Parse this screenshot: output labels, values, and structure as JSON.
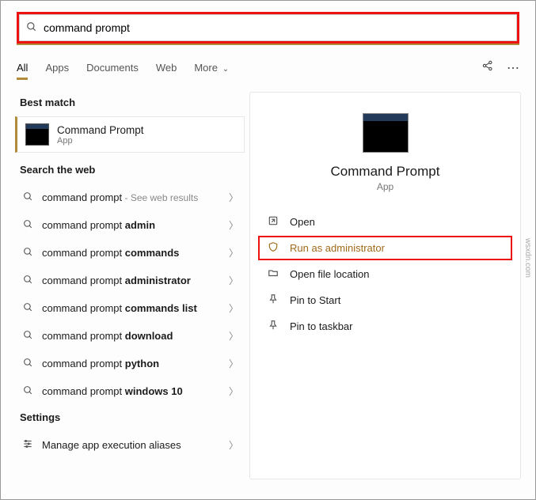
{
  "search": {
    "value": "command prompt"
  },
  "tabs": [
    "All",
    "Apps",
    "Documents",
    "Web",
    "More"
  ],
  "bestMatchHeader": "Best match",
  "bestMatch": {
    "title": "Command Prompt",
    "subtitle": "App"
  },
  "webHeader": "Search the web",
  "webItems": [
    {
      "prefix": "command prompt",
      "bold": "",
      "suffix": " - See web results"
    },
    {
      "prefix": "command prompt ",
      "bold": "admin",
      "suffix": ""
    },
    {
      "prefix": "command prompt ",
      "bold": "commands",
      "suffix": ""
    },
    {
      "prefix": "command prompt ",
      "bold": "administrator",
      "suffix": ""
    },
    {
      "prefix": "command prompt ",
      "bold": "commands list",
      "suffix": ""
    },
    {
      "prefix": "command prompt ",
      "bold": "download",
      "suffix": ""
    },
    {
      "prefix": "command prompt ",
      "bold": "python",
      "suffix": ""
    },
    {
      "prefix": "command prompt ",
      "bold": "windows 10",
      "suffix": ""
    }
  ],
  "settingsHeader": "Settings",
  "settingsItem": "Manage app execution aliases",
  "detail": {
    "title": "Command Prompt",
    "subtitle": "App",
    "actions": {
      "open": "Open",
      "runAdmin": "Run as administrator",
      "openLoc": "Open file location",
      "pinStart": "Pin to Start",
      "pinTaskbar": "Pin to taskbar"
    }
  },
  "watermark": "wsxdn.com"
}
